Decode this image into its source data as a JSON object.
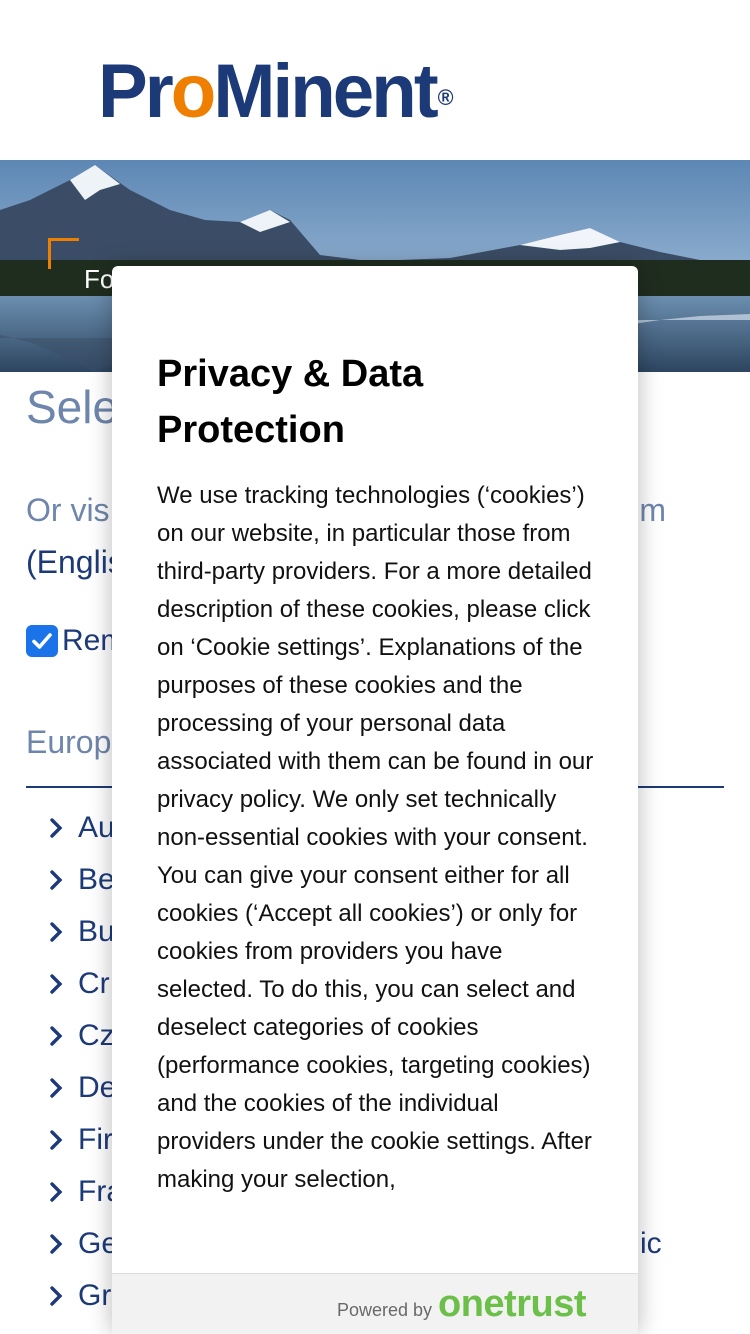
{
  "header": {
    "logo_part1": "Pro",
    "logo_part2": "Minent",
    "logo_mark": "®"
  },
  "hero": {
    "text": "Fo"
  },
  "page": {
    "title_partial": "Sele",
    "or_visit_line1_left": "Or vis",
    "or_visit_line1_right": "m",
    "or_visit_line2": "(Englis",
    "remember_label": "Rem",
    "region_heading": "Europ",
    "countries": [
      "Au",
      "Be",
      "Bu",
      "Cr",
      "Cz",
      "De",
      "Fir",
      "Fra",
      "Ge",
      "Gr"
    ],
    "side_text": "ic"
  },
  "consent": {
    "title": "Privacy & Data Protection",
    "body": "We use tracking technologies (‘cookies’) on our website, in particular those from third-party providers. For a more detailed description of these cookies, please click on ‘Cookie settings’. Explanations of the purposes of these cookies and the processing of your personal data associated with them can be found in our privacy policy. We only set technically non-essential cookies with your consent. You can give your consent either for all cookies (‘Accept all cookies’) or only for cookies from providers you have selected. To do this, you can select and deselect categories of cookies (performance cookies, targeting cookies) and the cookies of the individual providers under the cookie settings. After making your selection,",
    "powered_by": "Powered by",
    "brand": "onetrust"
  },
  "colors": {
    "brand_blue": "#1d3a78",
    "brand_orange": "#ee7f00",
    "onetrust_green": "#6cc04a",
    "checkbox_blue": "#1a73e8"
  },
  "icons": {
    "remember_checkbox": "checkmark-icon",
    "country_item": "chevron-right-icon"
  }
}
